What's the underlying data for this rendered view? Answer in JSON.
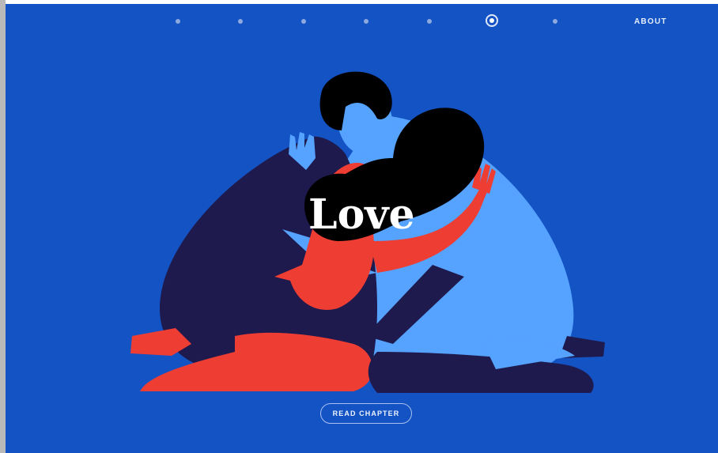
{
  "nav": {
    "dots": [
      {
        "active": false
      },
      {
        "active": false
      },
      {
        "active": false
      },
      {
        "active": false
      },
      {
        "active": false
      },
      {
        "active": true
      },
      {
        "active": false
      }
    ],
    "about_label": "ABOUT"
  },
  "hero": {
    "title": "Love",
    "illustration_icon": "embracing-couple-illustration"
  },
  "cta": {
    "label": "READ CHAPTER"
  },
  "colors": {
    "background": "#1353c4",
    "navy": "#1f1a4d",
    "light_blue": "#55a2ff",
    "red": "#ee3d33",
    "black": "#000000"
  }
}
